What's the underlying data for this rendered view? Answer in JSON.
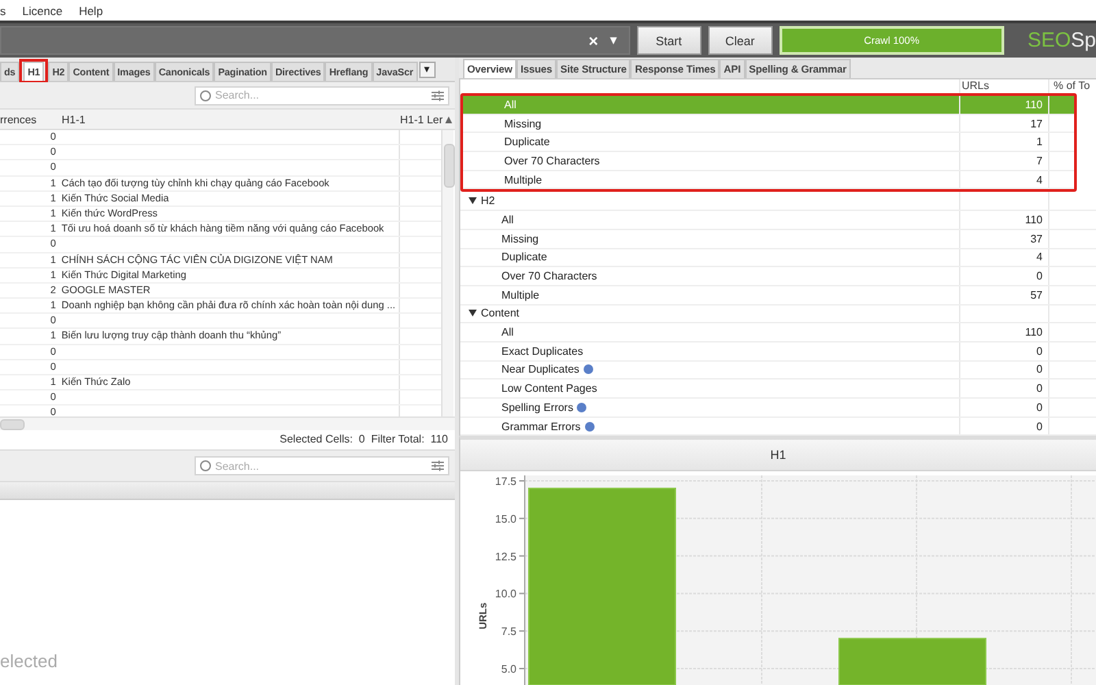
{
  "menu": [
    "s",
    "Licence",
    "Help"
  ],
  "toolbar": {
    "clear_glyph": "×",
    "dropdown_glyph": "▾",
    "buttons": [
      "Start",
      "Clear"
    ],
    "progress": {
      "label": "Crawl 100%",
      "level": 1
    },
    "logo": {
      "part_1": "SEO",
      "part_2": "Sp"
    }
  },
  "left_tabs": [
    {
      "label": "ds",
      "selected": false,
      "highlighted": false
    },
    {
      "label": "H1",
      "selected": true,
      "highlighted": true
    },
    {
      "label": "H2",
      "selected": false,
      "highlighted": false
    },
    {
      "label": "Content",
      "selected": false,
      "highlighted": false
    },
    {
      "label": "Images",
      "selected": false,
      "highlighted": false
    },
    {
      "label": "Canonicals",
      "selected": false,
      "highlighted": false
    },
    {
      "label": "Pagination",
      "selected": false,
      "highlighted": false
    },
    {
      "label": "Directives",
      "selected": false,
      "highlighted": false
    },
    {
      "label": "Hreflang",
      "selected": false,
      "highlighted": false
    },
    {
      "label": "JavaScr",
      "selected": false,
      "highlighted": false
    }
  ],
  "left_tabs_more": "▾",
  "right_tabs": [
    {
      "label": "Overview",
      "selected": true
    },
    {
      "label": "Issues",
      "selected": false
    },
    {
      "label": "Site Structure",
      "selected": false
    },
    {
      "label": "Response Times",
      "selected": false
    },
    {
      "label": "API",
      "selected": false
    },
    {
      "label": "Spelling & Grammar",
      "selected": false
    }
  ],
  "top_table": {
    "search_placeholder": "Search...",
    "columns": [
      "rrences",
      "H1-1",
      "H1-1 Ler"
    ],
    "rows": [
      [
        "0",
        ""
      ],
      [
        "0",
        ""
      ],
      [
        "0",
        ""
      ],
      [
        "1",
        "Cách tạo đối tượng tùy chỉnh khi chạy quảng cáo Facebook"
      ],
      [
        "1",
        "Kiến Thức Social Media"
      ],
      [
        "1",
        "Kiến thức WordPress"
      ],
      [
        "1",
        "Tối ưu hoá doanh số từ khách hàng tiềm năng với quảng cáo Facebook"
      ],
      [
        "0",
        ""
      ],
      [
        "1",
        "CHÍNH SÁCH CỘNG TÁC VIÊN CỦA DIGIZONE VIỆT NAM"
      ],
      [
        "1",
        "Kiến Thức Digital Marketing"
      ],
      [
        "2",
        "GOOGLE MASTER"
      ],
      [
        "1",
        "Doanh nghiệp bạn không cần phải đưa rõ chính xác hoàn toàn nội dung ..."
      ],
      [
        "0",
        ""
      ],
      [
        "1",
        "Biến lưu lượng truy cập thành doanh thu “khủng”"
      ],
      [
        "0",
        ""
      ],
      [
        "0",
        ""
      ],
      [
        "1",
        "Kiến Thức Zalo"
      ],
      [
        "0",
        ""
      ],
      [
        "0",
        ""
      ]
    ],
    "status": "Selected Cells:  0  Filter Total:  110"
  },
  "overview": {
    "columns": [
      "URLs",
      "% of To"
    ],
    "groups": [
      {
        "expanded": true,
        "highlighted": true,
        "items": [
          {
            "label": "All",
            "count": "110",
            "selected": true,
            "info": false
          },
          {
            "label": "Missing",
            "count": "17",
            "selected": false,
            "info": false
          },
          {
            "label": "Duplicate",
            "count": "1",
            "selected": false,
            "info": false
          },
          {
            "label": "Over 70 Characters",
            "count": "7",
            "selected": false,
            "info": false
          },
          {
            "label": "Multiple",
            "count": "4",
            "selected": false,
            "info": false
          }
        ]
      },
      {
        "label": "H2",
        "expanded": true,
        "highlighted": false,
        "items": [
          {
            "label": "All",
            "count": "110",
            "selected": false,
            "info": false
          },
          {
            "label": "Missing",
            "count": "37",
            "selected": false,
            "info": false
          },
          {
            "label": "Duplicate",
            "count": "4",
            "selected": false,
            "info": false
          },
          {
            "label": "Over 70 Characters",
            "count": "0",
            "selected": false,
            "info": false
          },
          {
            "label": "Multiple",
            "count": "57",
            "selected": false,
            "info": false
          }
        ]
      },
      {
        "label": "Content",
        "expanded": true,
        "highlighted": false,
        "items": [
          {
            "label": "All",
            "count": "110",
            "selected": false,
            "info": false
          },
          {
            "label": "Exact Duplicates",
            "count": "0",
            "selected": false,
            "info": false
          },
          {
            "label": "Near Duplicates",
            "count": "0",
            "selected": false,
            "info": true
          },
          {
            "label": "Low Content Pages",
            "count": "0",
            "selected": false,
            "info": false
          },
          {
            "label": "Spelling Errors",
            "count": "0",
            "selected": false,
            "info": true
          },
          {
            "label": "Grammar Errors",
            "count": "0",
            "selected": false,
            "info": true
          }
        ]
      }
    ]
  },
  "bottom_left": {
    "search_placeholder": "Search...",
    "message": "elected"
  },
  "chart_panel": {
    "title": "H1",
    "chart_data": {
      "type": "bar",
      "grid": true,
      "ylabel": "URLs",
      "values": [
        17,
        null,
        7
      ],
      "ylim": [
        4,
        17.5
      ],
      "yticks": [
        {
          "value": 5,
          "label": "5.0"
        },
        {
          "value": 7.5,
          "label": "7.5"
        },
        {
          "value": 10,
          "label": "10.0"
        },
        {
          "value": 12.5,
          "label": "12.5"
        },
        {
          "value": 15,
          "label": "15.0"
        },
        {
          "value": 17.5,
          "label": "17.5"
        }
      ]
    }
  }
}
